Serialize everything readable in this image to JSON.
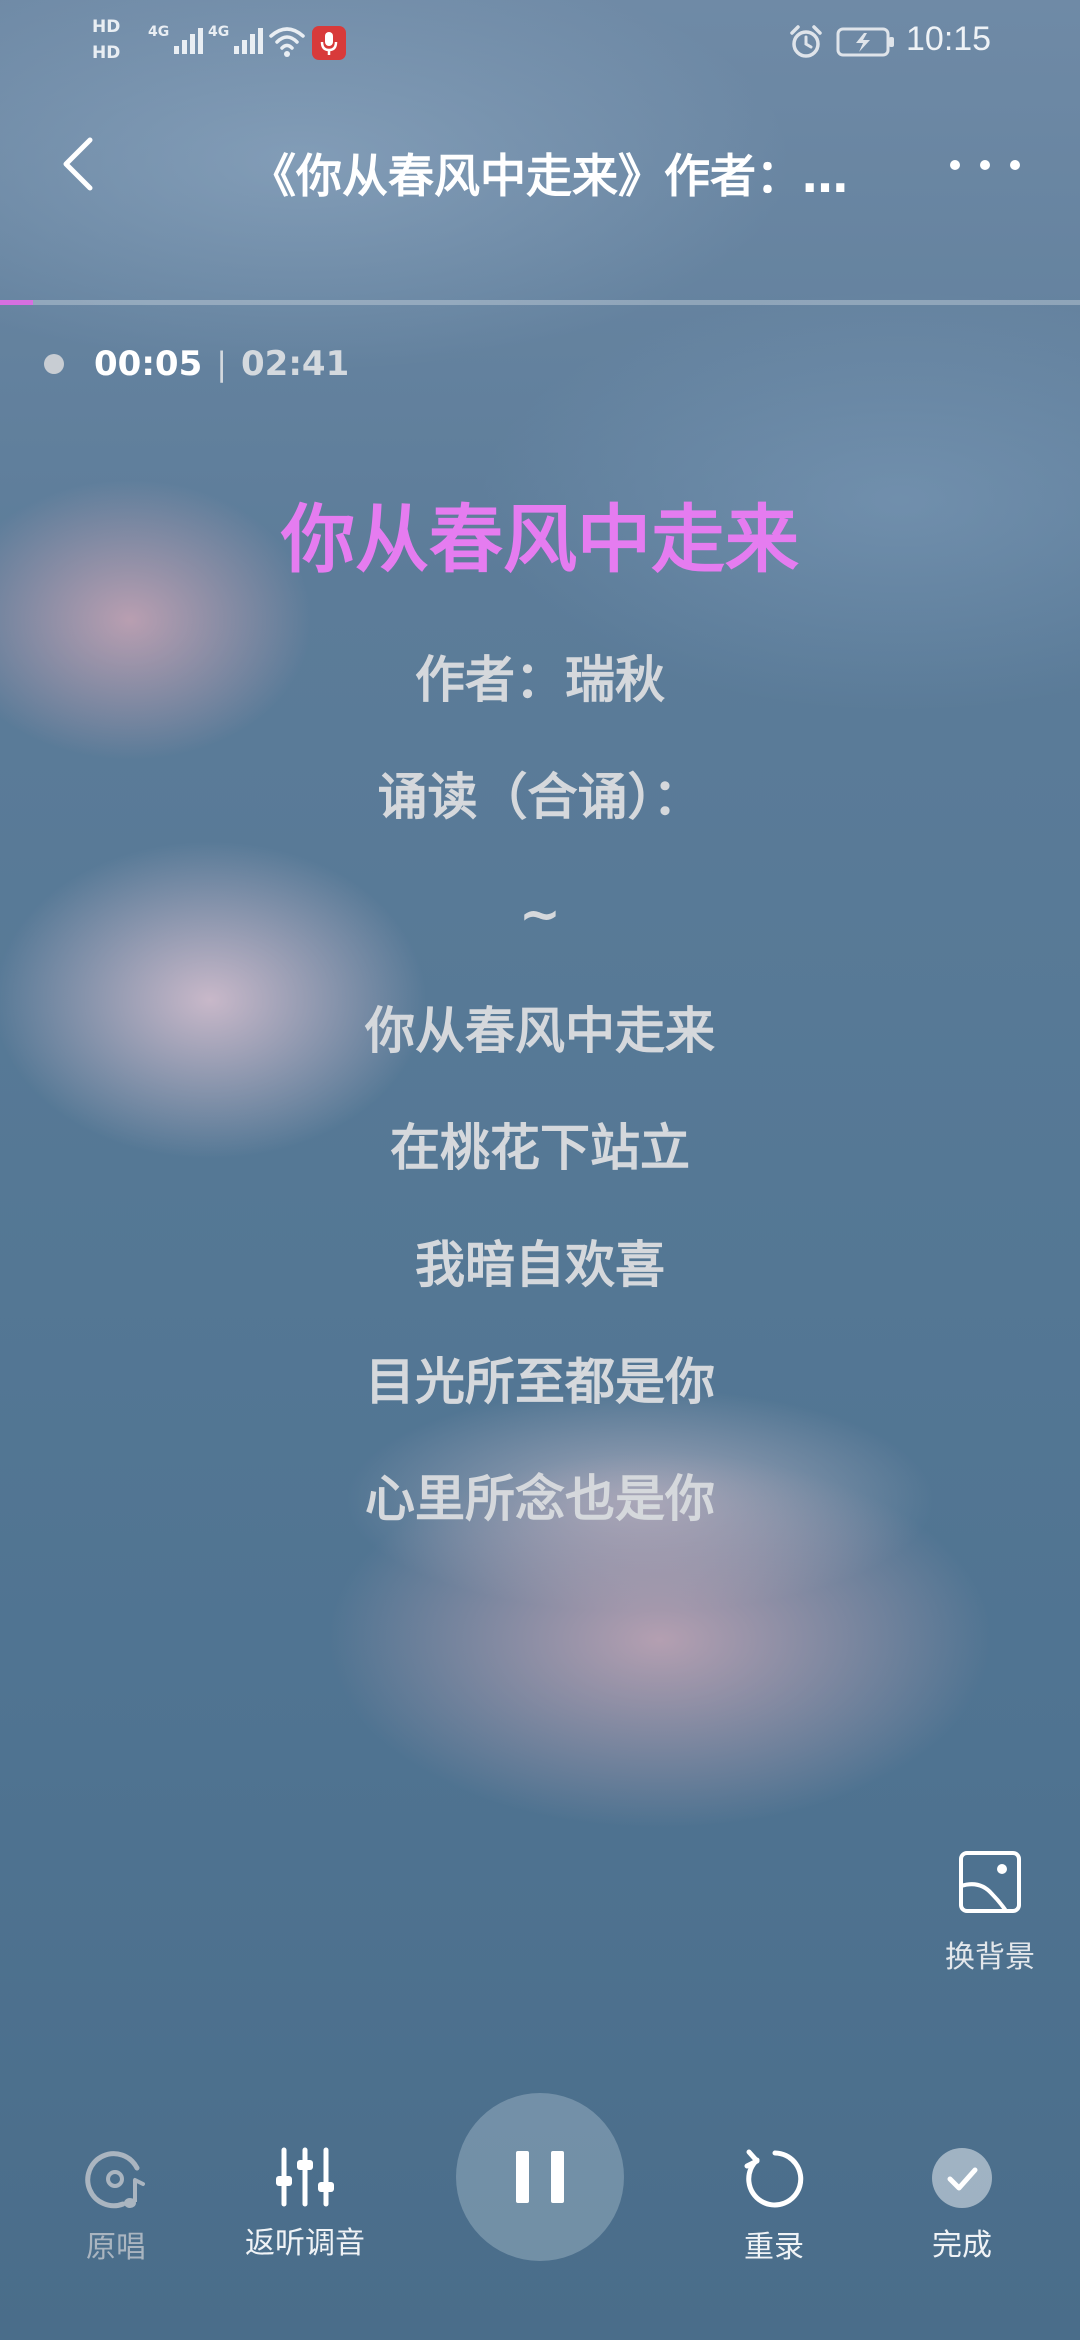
{
  "status_bar": {
    "hd1": "HD",
    "hd2": "HD",
    "sim1_label": "4G",
    "sim2_label": "4G",
    "time": "10:15",
    "icons": [
      "signal-icon",
      "wifi-icon",
      "mic-icon",
      "alarm-icon",
      "battery-charging-icon"
    ]
  },
  "header": {
    "title": "《你从春风中走来》作者：瑞秋",
    "back_icon": "back-arrow-icon",
    "more_icon": "more-dots-icon"
  },
  "progress": {
    "fraction": 0.031,
    "current": "00:05",
    "separator": "|",
    "total": "02:41",
    "accent": "#d76fe0"
  },
  "lyrics": {
    "title": "你从春风中走来",
    "title_color": "#e57cf0",
    "lines": [
      "作者：瑞秋",
      "诵读（合诵）：",
      "~",
      "你从春风中走来",
      "在桃花下站立",
      "我暗自欢喜",
      "目光所至都是你",
      "心里所念也是你"
    ]
  },
  "change_background": {
    "label": "换背景",
    "icon": "image-icon"
  },
  "controls": {
    "original": {
      "label": "原唱",
      "icon": "original-vocal-icon"
    },
    "tune": {
      "label": "返听调音",
      "icon": "equalizer-icon"
    },
    "pause": {
      "icon": "pause-icon"
    },
    "rerecord": {
      "label": "重录",
      "icon": "refresh-icon"
    },
    "done": {
      "label": "完成",
      "icon": "check-icon"
    }
  }
}
